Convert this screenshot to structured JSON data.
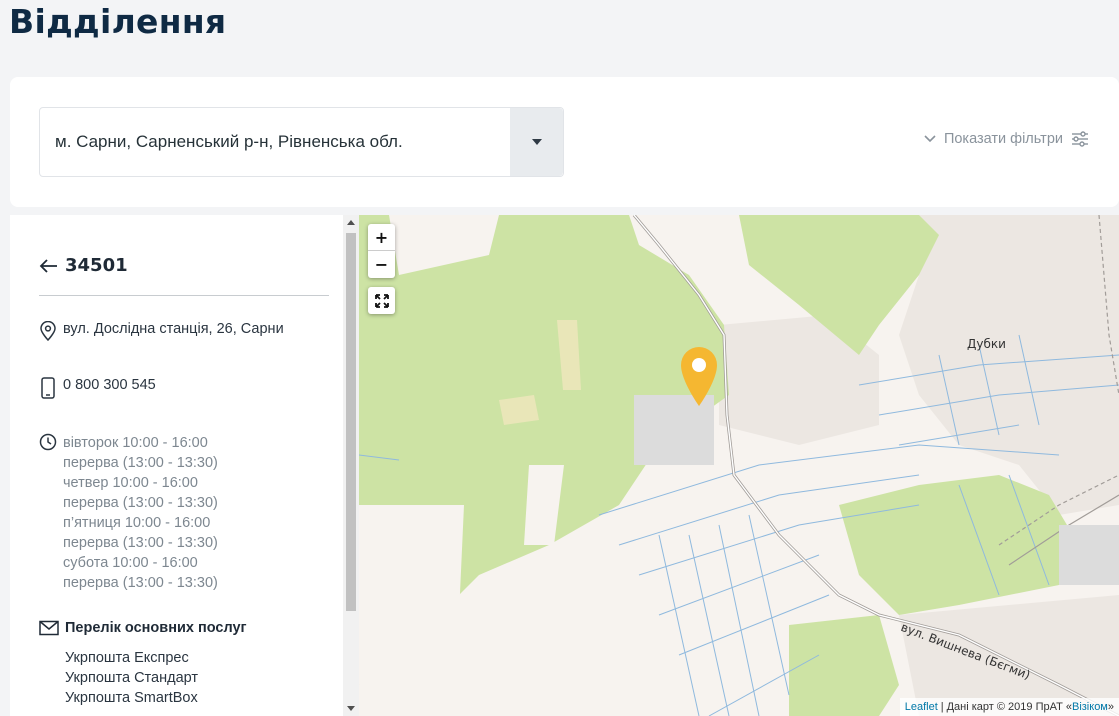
{
  "page": {
    "title": "Відділення"
  },
  "search": {
    "location_value": "м. Сарни, Сарненський р-н, Рівненська обл.",
    "filters_label": "Показати фільтри"
  },
  "office": {
    "code": "34501",
    "address": "вул. Дослідна станція, 26, Сарни",
    "phone": "0 800 300 545",
    "schedule": [
      "вівторок 10:00 - 16:00",
      "перерва (13:00 - 13:30)",
      "четвер 10:00 - 16:00",
      "перерва (13:00 - 13:30)",
      "п’ятниця 10:00 - 16:00",
      "перерва (13:00 - 13:30)",
      "субота 10:00 - 16:00",
      "перерва (13:00 - 13:30)"
    ],
    "services_title": "Перелік основних послуг",
    "services": [
      "Укрпошта Експрес",
      "Укрпошта Стандарт",
      "Укрпошта SmartBox"
    ]
  },
  "map": {
    "zoom_in": "+",
    "zoom_out": "−",
    "labels": {
      "village": "Дубки",
      "street": "вул. Вишнева (Бєгми)"
    },
    "attribution": {
      "leaflet": "Leaflet",
      "separator": "|",
      "text": "Дані карт © 2019 ПрАТ «",
      "provider": "Візіком",
      "closing": "»"
    },
    "colors": {
      "forest": "#cde3a4",
      "land": "#f7f3ef",
      "urban": "#ece7e2",
      "water_lines": "#8fb9de",
      "road": "#b0aaa5",
      "marker": "#f5b731"
    }
  }
}
